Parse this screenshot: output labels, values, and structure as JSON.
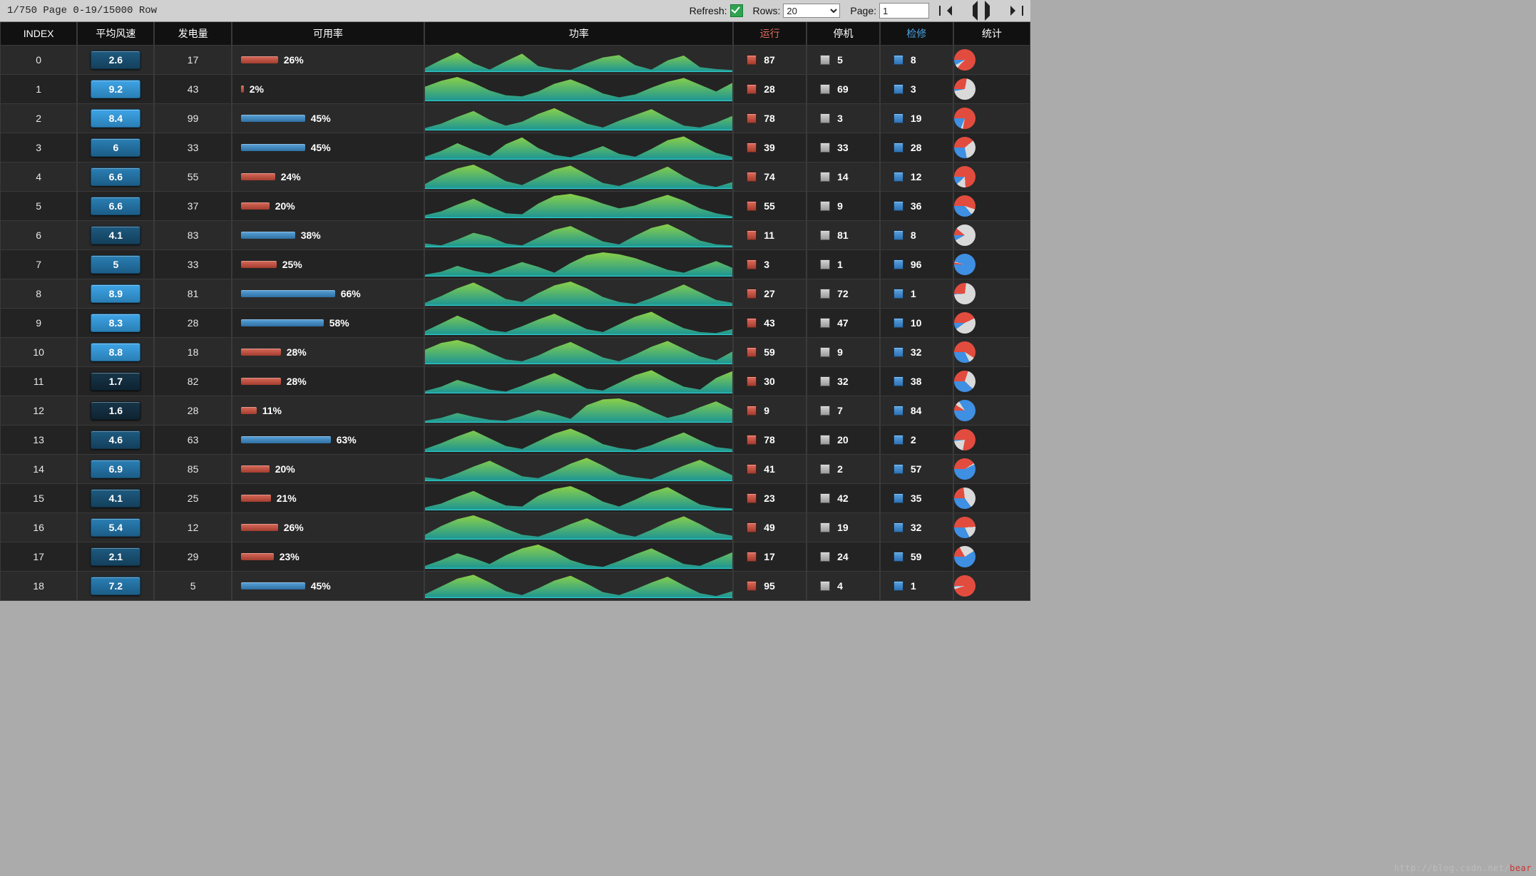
{
  "toolbar": {
    "status": "1/750 Page 0-19/15000 Row",
    "refresh_label": "Refresh:",
    "refresh_checked": true,
    "rows_label": "Rows:",
    "rows_value": "20",
    "page_label": "Page:",
    "page_value": "1"
  },
  "columns": {
    "index": "INDEX",
    "wind": "平均风速",
    "gen": "发电量",
    "avail": "可用率",
    "power": "功率",
    "run": "运行",
    "stop": "停机",
    "maint": "检修",
    "stat": "统计"
  },
  "rows": [
    {
      "index": 0,
      "wind": 2.6,
      "gen": 17,
      "avail_pct": 26,
      "avail_color": "red",
      "run": 87,
      "stop": 5,
      "maint": 8,
      "spark": [
        8,
        25,
        40,
        18,
        5,
        22,
        38,
        12,
        6,
        4,
        18,
        30,
        35,
        14,
        5,
        24,
        34,
        10,
        6,
        4
      ],
      "pie": [
        87,
        5,
        8
      ]
    },
    {
      "index": 1,
      "wind": 9.2,
      "gen": 43,
      "avail_pct": 2,
      "avail_color": "red",
      "run": 28,
      "stop": 69,
      "maint": 3,
      "spark": [
        30,
        42,
        50,
        38,
        22,
        12,
        10,
        20,
        36,
        45,
        32,
        16,
        8,
        14,
        28,
        40,
        48,
        34,
        20,
        38
      ],
      "pie": [
        28,
        69,
        3
      ]
    },
    {
      "index": 2,
      "wind": 8.4,
      "gen": 99,
      "avail_pct": 45,
      "avail_color": "blue",
      "run": 78,
      "stop": 3,
      "maint": 19,
      "spark": [
        5,
        14,
        28,
        40,
        22,
        10,
        18,
        34,
        46,
        30,
        14,
        6,
        20,
        32,
        44,
        26,
        10,
        6,
        16,
        30
      ],
      "pie": [
        78,
        3,
        19
      ]
    },
    {
      "index": 3,
      "wind": 6.0,
      "gen": 33,
      "avail_pct": 45,
      "avail_color": "blue",
      "run": 39,
      "stop": 33,
      "maint": 28,
      "spark": [
        6,
        18,
        34,
        20,
        8,
        32,
        46,
        24,
        10,
        5,
        16,
        28,
        12,
        6,
        22,
        40,
        48,
        30,
        14,
        6
      ],
      "pie": [
        39,
        33,
        28
      ]
    },
    {
      "index": 4,
      "wind": 6.6,
      "gen": 55,
      "avail_pct": 24,
      "avail_color": "red",
      "run": 74,
      "stop": 14,
      "maint": 12,
      "spark": [
        10,
        28,
        42,
        50,
        34,
        16,
        8,
        24,
        40,
        48,
        30,
        12,
        6,
        18,
        32,
        46,
        26,
        10,
        4,
        14
      ],
      "pie": [
        74,
        14,
        12
      ]
    },
    {
      "index": 5,
      "wind": 6.6,
      "gen": 37,
      "avail_pct": 20,
      "avail_color": "red",
      "run": 55,
      "stop": 9,
      "maint": 36,
      "spark": [
        6,
        14,
        28,
        40,
        24,
        10,
        8,
        30,
        46,
        50,
        42,
        30,
        20,
        26,
        38,
        48,
        36,
        20,
        10,
        4
      ],
      "pie": [
        55,
        9,
        36
      ]
    },
    {
      "index": 6,
      "wind": 4.1,
      "gen": 83,
      "avail_pct": 38,
      "avail_color": "blue",
      "run": 11,
      "stop": 81,
      "maint": 8,
      "spark": [
        8,
        4,
        16,
        30,
        22,
        8,
        4,
        20,
        36,
        44,
        28,
        12,
        6,
        24,
        40,
        48,
        32,
        14,
        6,
        4
      ],
      "pie": [
        11,
        81,
        8
      ]
    },
    {
      "index": 7,
      "wind": 5.0,
      "gen": 33,
      "avail_pct": 25,
      "avail_color": "red",
      "run": 3,
      "stop": 1,
      "maint": 96,
      "spark": [
        4,
        10,
        22,
        12,
        6,
        18,
        30,
        20,
        8,
        28,
        44,
        50,
        46,
        38,
        26,
        14,
        8,
        20,
        32,
        18
      ],
      "pie": [
        3,
        1,
        96
      ]
    },
    {
      "index": 8,
      "wind": 8.9,
      "gen": 81,
      "avail_pct": 66,
      "avail_color": "blue",
      "run": 27,
      "stop": 72,
      "maint": 1,
      "spark": [
        6,
        20,
        36,
        48,
        32,
        14,
        8,
        26,
        42,
        50,
        36,
        18,
        8,
        4,
        16,
        30,
        44,
        28,
        12,
        6
      ],
      "pie": [
        27,
        72,
        1
      ]
    },
    {
      "index": 9,
      "wind": 8.3,
      "gen": 28,
      "avail_pct": 58,
      "avail_color": "blue",
      "run": 43,
      "stop": 47,
      "maint": 10,
      "spark": [
        8,
        24,
        40,
        26,
        10,
        6,
        18,
        32,
        44,
        28,
        12,
        6,
        22,
        38,
        48,
        30,
        14,
        6,
        4,
        12
      ],
      "pie": [
        43,
        47,
        10
      ]
    },
    {
      "index": 10,
      "wind": 8.8,
      "gen": 18,
      "avail_pct": 28,
      "avail_color": "red",
      "run": 59,
      "stop": 9,
      "maint": 32,
      "spark": [
        30,
        44,
        50,
        40,
        24,
        10,
        6,
        18,
        34,
        46,
        30,
        14,
        6,
        20,
        36,
        48,
        32,
        16,
        8,
        26
      ],
      "pie": [
        59,
        9,
        32
      ]
    },
    {
      "index": 11,
      "wind": 1.7,
      "gen": 82,
      "avail_pct": 28,
      "avail_color": "red",
      "run": 30,
      "stop": 32,
      "maint": 38,
      "spark": [
        5,
        14,
        28,
        18,
        8,
        4,
        16,
        30,
        42,
        26,
        10,
        6,
        22,
        38,
        48,
        30,
        14,
        8,
        32,
        46
      ],
      "pie": [
        30,
        32,
        38
      ]
    },
    {
      "index": 12,
      "wind": 1.6,
      "gen": 28,
      "avail_pct": 11,
      "avail_color": "red",
      "run": 9,
      "stop": 7,
      "maint": 84,
      "spark": [
        4,
        10,
        20,
        12,
        6,
        4,
        14,
        26,
        18,
        8,
        36,
        48,
        50,
        40,
        24,
        10,
        18,
        32,
        44,
        28
      ],
      "pie": [
        9,
        7,
        84
      ]
    },
    {
      "index": 13,
      "wind": 4.6,
      "gen": 63,
      "avail_pct": 63,
      "avail_color": "blue",
      "run": 78,
      "stop": 20,
      "maint": 2,
      "spark": [
        6,
        18,
        32,
        44,
        28,
        12,
        6,
        22,
        38,
        48,
        34,
        16,
        8,
        4,
        14,
        28,
        40,
        24,
        10,
        6
      ],
      "pie": [
        78,
        20,
        2
      ]
    },
    {
      "index": 14,
      "wind": 6.9,
      "gen": 85,
      "avail_pct": 20,
      "avail_color": "red",
      "run": 41,
      "stop": 2,
      "maint": 57,
      "spark": [
        8,
        4,
        16,
        30,
        42,
        26,
        10,
        6,
        20,
        36,
        48,
        32,
        14,
        8,
        4,
        18,
        32,
        44,
        28,
        12
      ],
      "pie": [
        41,
        2,
        57
      ]
    },
    {
      "index": 15,
      "wind": 4.1,
      "gen": 25,
      "avail_pct": 21,
      "avail_color": "red",
      "run": 23,
      "stop": 42,
      "maint": 35,
      "spark": [
        6,
        14,
        28,
        40,
        24,
        10,
        8,
        30,
        44,
        50,
        36,
        18,
        8,
        22,
        38,
        48,
        30,
        12,
        6,
        4
      ],
      "pie": [
        23,
        42,
        35
      ]
    },
    {
      "index": 16,
      "wind": 5.4,
      "gen": 12,
      "avail_pct": 26,
      "avail_color": "red",
      "run": 49,
      "stop": 19,
      "maint": 32,
      "spark": [
        10,
        28,
        42,
        50,
        38,
        22,
        10,
        6,
        18,
        32,
        44,
        28,
        12,
        6,
        20,
        36,
        48,
        32,
        14,
        8
      ],
      "pie": [
        49,
        19,
        32
      ]
    },
    {
      "index": 17,
      "wind": 2.1,
      "gen": 29,
      "avail_pct": 23,
      "avail_color": "red",
      "run": 17,
      "stop": 24,
      "maint": 59,
      "spark": [
        6,
        18,
        32,
        22,
        10,
        28,
        42,
        50,
        36,
        18,
        8,
        4,
        16,
        30,
        42,
        26,
        10,
        6,
        20,
        34
      ],
      "pie": [
        17,
        24,
        59
      ]
    },
    {
      "index": 18,
      "wind": 7.2,
      "gen": 5,
      "avail_pct": 45,
      "avail_color": "blue",
      "run": 95,
      "stop": 4,
      "maint": 1,
      "spark": [
        8,
        24,
        40,
        48,
        32,
        14,
        6,
        20,
        36,
        46,
        30,
        12,
        6,
        18,
        32,
        44,
        26,
        10,
        4,
        14
      ],
      "pie": [
        95,
        4,
        1
      ]
    }
  ],
  "watermark": "http://blog.csdn.net/",
  "watermark_tail": "bear"
}
